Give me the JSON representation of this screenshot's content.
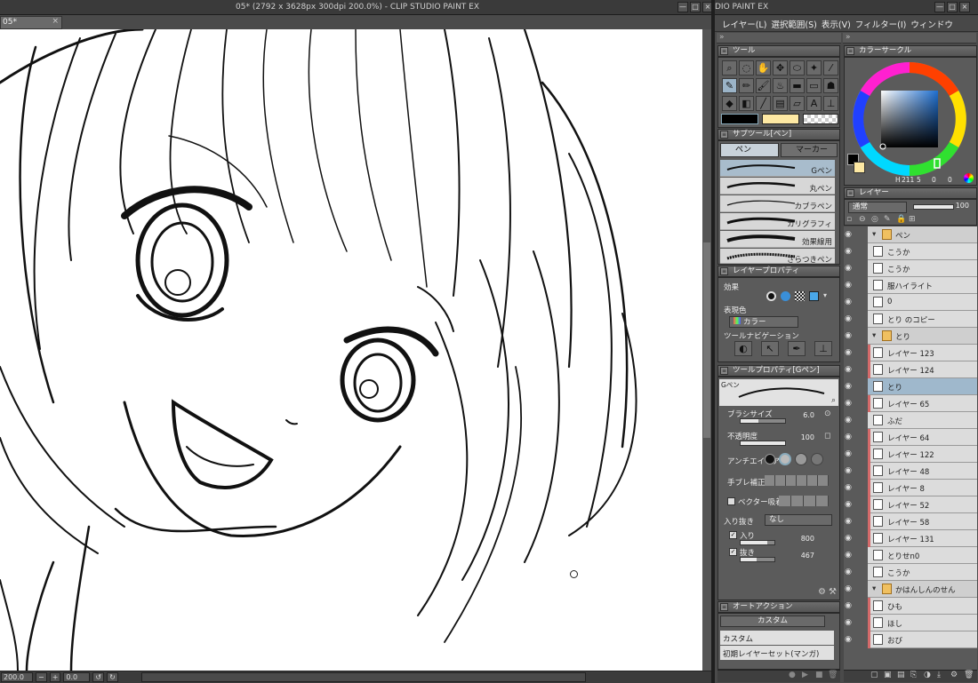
{
  "window": {
    "title": "05* (2792 x 3628px 300dpi 200.0%) - CLIP STUDIO PAINT EX",
    "right_title": "DIO PAINT EX",
    "tab_label": "05*",
    "tab_close": "×",
    "minimize": "—",
    "maximize": "□",
    "close": "×"
  },
  "menu": [
    "レイヤー(L)",
    "選択範囲(S)",
    "表示(V)",
    "フィルター(I)",
    "ウィンドウ"
  ],
  "panels": {
    "tool": "ツール",
    "sub_tool": "サブツール[ペン]",
    "layer_property": "レイヤープロパティ",
    "tool_property": "ツールプロパティ[Gペン]",
    "auto_action": "オートアクション",
    "color_circle": "カラーサークル",
    "layer": "レイヤー"
  },
  "subtool_tabs": [
    "ペン",
    "マーカー"
  ],
  "brushes": [
    {
      "name": "Gペン",
      "selected": true
    },
    {
      "name": "丸ペン",
      "selected": false
    },
    {
      "name": "カブラペン",
      "selected": false
    },
    {
      "name": "カリグラフィ",
      "selected": false
    },
    {
      "name": "効果線用",
      "selected": false
    },
    {
      "name": "ざらつきペン",
      "selected": false
    }
  ],
  "layer_property": {
    "effect_label": "効果",
    "expression_color_label": "表現色",
    "expression_color_value": "カラー",
    "tool_nav_label": "ツールナビゲーション"
  },
  "tool_property": {
    "preview_label": "Gペン",
    "brush_size_label": "ブラシサイズ",
    "brush_size": 6.0,
    "brush_size_text": "6.0",
    "opacity_label": "不透明度",
    "opacity": 100,
    "opacity_text": "100",
    "antialias_label": "アンチエイリアス",
    "stabilization_label": "手ブレ補正",
    "vector_snap_label": "ベクター吸着",
    "taper_label": "入り抜き",
    "taper_value": "なし",
    "in_label": "入り",
    "in_value": 800,
    "in_text": "800",
    "out_label": "抜き",
    "out_value": 467,
    "out_text": "467"
  },
  "auto_action": {
    "set_name": "カスタム",
    "items": [
      "カスタム",
      "初期レイヤーセット(マンガ)"
    ]
  },
  "color": {
    "hsv_h": "211",
    "hsv_s": "5",
    "hsv_v": "0",
    "hsv_v2": "0",
    "h_label": "H",
    "s_label": "S",
    "v_label": "V",
    "main_color": "#000000",
    "sub_color": "#fde8a3",
    "ring_colors": [
      "#ff0000",
      "#ffff00",
      "#00ff00",
      "#00ffff",
      "#0000ff",
      "#ff00ff"
    ]
  },
  "layer_panel": {
    "blend_mode": "通常",
    "opacity_text": "100",
    "layers": [
      {
        "name": "ペン",
        "type": "folder",
        "selected": false,
        "red": false
      },
      {
        "name": "こうか",
        "type": "layer",
        "selected": false,
        "red": false
      },
      {
        "name": "こうか",
        "type": "layer",
        "selected": false,
        "red": false
      },
      {
        "name": "服ハイライト",
        "type": "layer",
        "selected": false,
        "red": false
      },
      {
        "name": "0",
        "type": "layer",
        "selected": false,
        "red": false
      },
      {
        "name": "とり のコピー",
        "type": "layer",
        "selected": false,
        "red": false
      },
      {
        "name": "とり",
        "type": "folder",
        "selected": false,
        "red": false
      },
      {
        "name": "レイヤー 123",
        "type": "layer",
        "selected": false,
        "red": true
      },
      {
        "name": "レイヤー 124",
        "type": "layer",
        "selected": false,
        "red": true
      },
      {
        "name": "とり",
        "type": "layer",
        "selected": true,
        "red": false
      },
      {
        "name": "レイヤー 65",
        "type": "layer",
        "selected": false,
        "red": true
      },
      {
        "name": "ふだ",
        "type": "layer",
        "selected": false,
        "red": false
      },
      {
        "name": "レイヤー 64",
        "type": "layer",
        "selected": false,
        "red": true
      },
      {
        "name": "レイヤー 122",
        "type": "layer",
        "selected": false,
        "red": true
      },
      {
        "name": "レイヤー 48",
        "type": "layer",
        "selected": false,
        "red": true
      },
      {
        "name": "レイヤー 8",
        "type": "layer",
        "selected": false,
        "red": true
      },
      {
        "name": "レイヤー 52",
        "type": "layer",
        "selected": false,
        "red": true
      },
      {
        "name": "レイヤー 58",
        "type": "layer",
        "selected": false,
        "red": true
      },
      {
        "name": "レイヤー 131",
        "type": "layer",
        "selected": false,
        "red": true
      },
      {
        "name": "とりせn0",
        "type": "layer",
        "selected": false,
        "red": false
      },
      {
        "name": "こうか",
        "type": "layer",
        "selected": false,
        "red": false
      },
      {
        "name": "かはんしんのせん",
        "type": "folder",
        "selected": false,
        "red": false
      },
      {
        "name": "ひも",
        "type": "layer",
        "selected": false,
        "red": true
      },
      {
        "name": "ほし",
        "type": "layer",
        "selected": false,
        "red": true
      },
      {
        "name": "おび",
        "type": "layer",
        "selected": false,
        "red": true
      }
    ]
  },
  "status": {
    "zoom": "200.0",
    "angle": "0.0"
  }
}
